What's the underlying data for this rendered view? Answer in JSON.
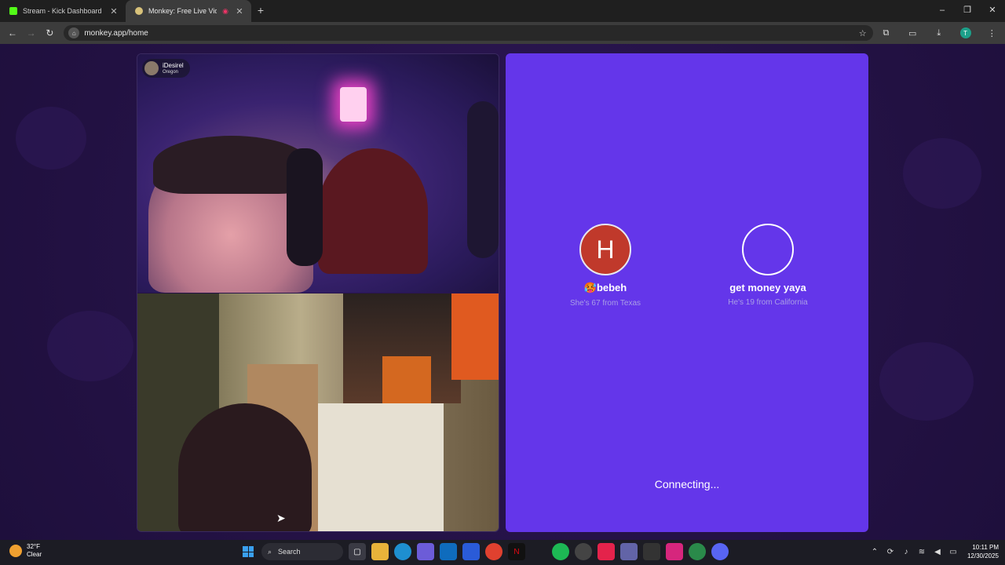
{
  "browser": {
    "tabs": [
      {
        "title": "Stream - Kick Dashboard",
        "favicon_color": "#53fc18",
        "active": false
      },
      {
        "title": "Monkey: Free Live Video Cl",
        "favicon_color": "#d8c27a",
        "active": true
      }
    ],
    "url": "monkey.app/home",
    "profile_initial": "T",
    "window_controls": {
      "minimize": "–",
      "maximize": "❐",
      "close": "✕"
    }
  },
  "call": {
    "self_user": {
      "name": "iDesirel",
      "location": "Oregon"
    },
    "status": "Connecting..."
  },
  "match_panel": {
    "accent": "#6436ea",
    "people": [
      {
        "initial": "H",
        "emoji": "🥵",
        "name": "bebeh",
        "subtitle": "She's 67 from Texas",
        "avatar_color": "#c0392b"
      },
      {
        "initial": "",
        "emoji": "",
        "name": "get money yaya",
        "subtitle": "He's 19 from California",
        "avatar_color": "transparent"
      }
    ]
  },
  "taskbar": {
    "weather": {
      "temp": "32°F",
      "condition": "Clear"
    },
    "search_label": "Search",
    "clock": {
      "time": "10:11 PM",
      "date": "12/30/2025"
    }
  }
}
